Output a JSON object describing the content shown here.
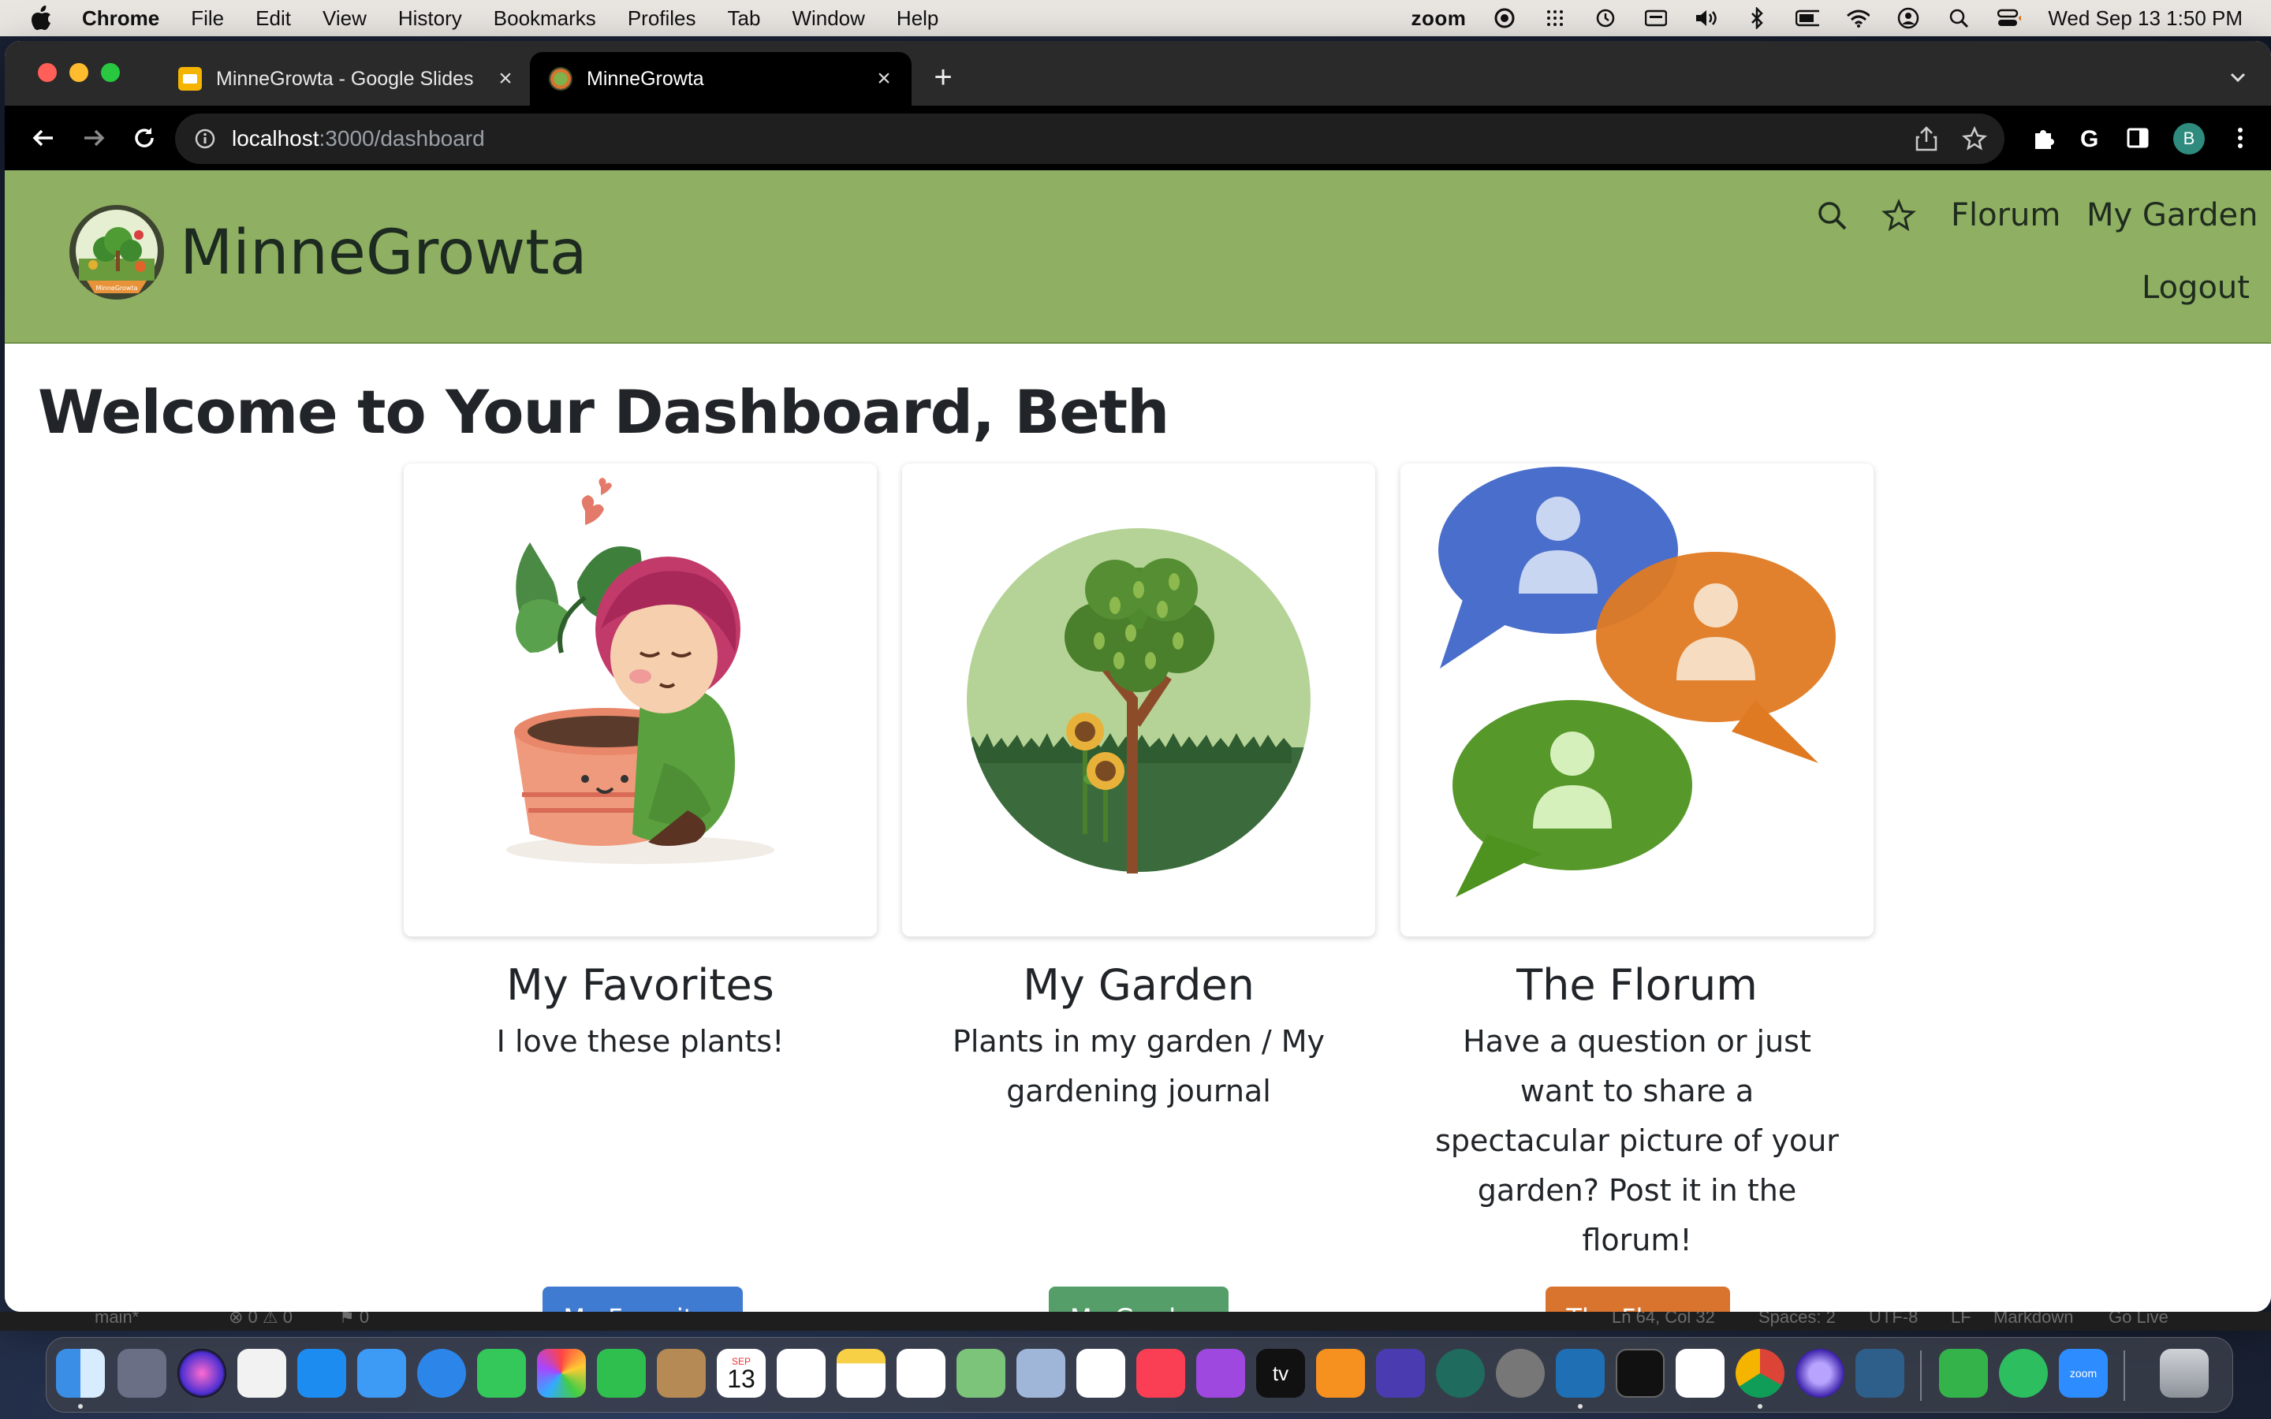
{
  "menubar": {
    "app_name": "Chrome",
    "items": [
      "File",
      "Edit",
      "View",
      "History",
      "Bookmarks",
      "Profiles",
      "Tab",
      "Window",
      "Help"
    ],
    "zoom_label": "zoom",
    "datetime": "Wed Sep 13  1:50 PM"
  },
  "browser": {
    "tabs": [
      {
        "label": "MinneGrowta - Google Slides",
        "active": false
      },
      {
        "label": "MinneGrowta",
        "active": true
      }
    ],
    "url_host": "localhost",
    "url_rest": ":3000/dashboard",
    "profile_initial": "B"
  },
  "site": {
    "brand": "MinneGrowta",
    "nav": {
      "florum": "Florum",
      "my_garden": "My Garden",
      "logout": "Logout"
    },
    "header_color": "#8faf62"
  },
  "dashboard": {
    "welcome": "Welcome to Your Dashboard, Beth",
    "cards": [
      {
        "title": "My Favorites",
        "text": "I love these plants!",
        "button": "My Favorites",
        "button_color": "#3f7bd0"
      },
      {
        "title": "My Garden",
        "text": "Plants in my garden / My gardening journal",
        "button": "My Garden",
        "button_color": "#559e6a"
      },
      {
        "title": "The Florum",
        "text": "Have a question or just want to share a spectacular picture of your garden? Post it in the florum!",
        "button": "The Florum",
        "button_color": "#d9742f"
      }
    ]
  },
  "status_strip": {
    "branch": "main*",
    "problems": "⊗ 0 ⚠ 0",
    "ports": "⚑ 0",
    "position": "Ln 64, Col 32",
    "spaces": "Spaces: 2",
    "encoding": "UTF-8",
    "eol": "LF",
    "language": "Markdown",
    "golive": "Go Live"
  },
  "dock": {
    "calendar_month": "SEP",
    "calendar_day": "13",
    "tv_label": "tv",
    "zoom_label": "zoom"
  }
}
